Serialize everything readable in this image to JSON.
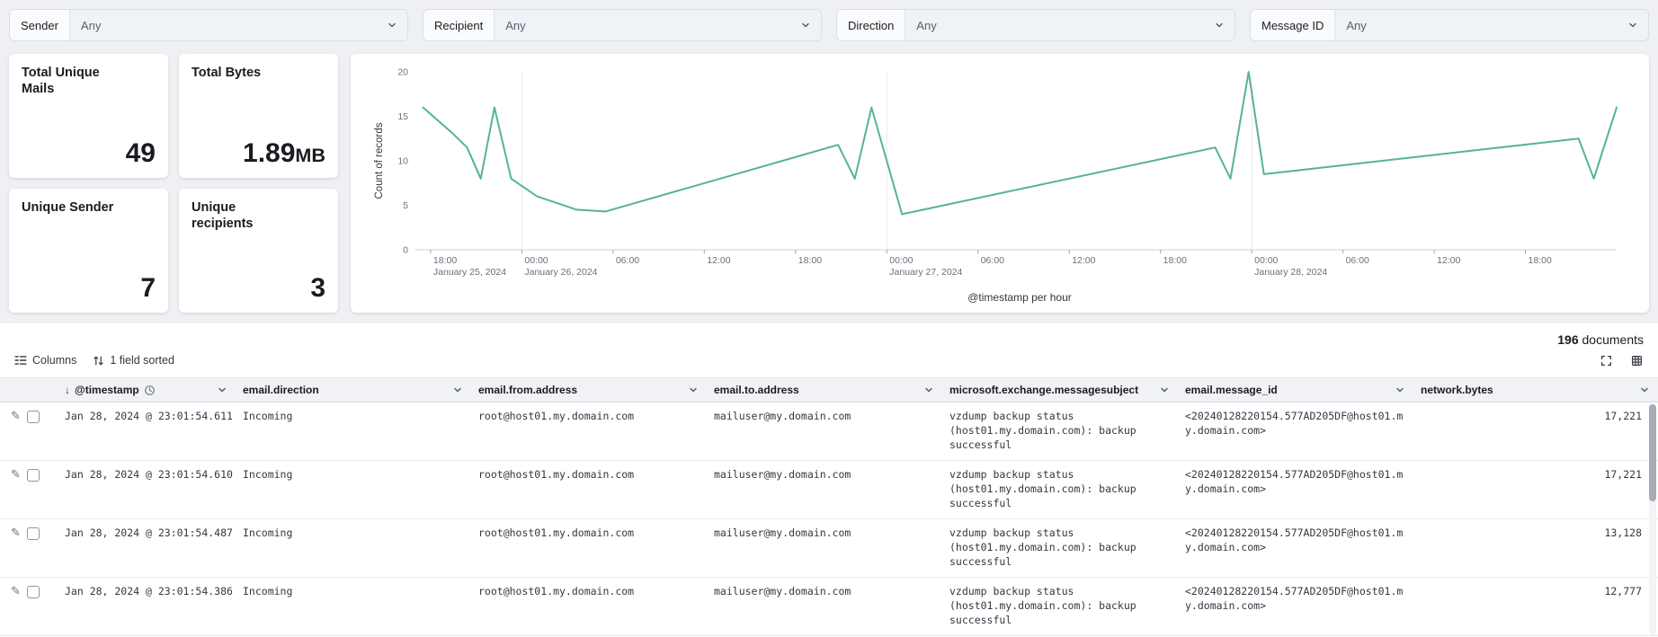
{
  "filters": [
    {
      "label": "Sender",
      "value": "Any"
    },
    {
      "label": "Recipient",
      "value": "Any"
    },
    {
      "label": "Direction",
      "value": "Any"
    },
    {
      "label": "Message ID",
      "value": "Any"
    }
  ],
  "metrics": [
    {
      "title": "Total Unique Mails",
      "value": "49",
      "unit": ""
    },
    {
      "title": "Total Bytes",
      "value": "1.89",
      "unit": "MB"
    },
    {
      "title": "Unique Sender",
      "value": "7",
      "unit": ""
    },
    {
      "title": "Unique recipients",
      "value": "3",
      "unit": ""
    }
  ],
  "chart_data": {
    "type": "line",
    "ylabel": "Count of records",
    "xlabel": "@timestamp per hour",
    "ylim": [
      0,
      20
    ],
    "y_ticks": [
      0,
      5,
      10,
      15,
      20
    ],
    "x_domain_hours": [
      0,
      79
    ],
    "x_domain_note": "hours since 2024-01-25 17:00",
    "line_color": "#54b399",
    "grid_color": "#e6e9ef",
    "day_gridlines_hours": [
      7,
      31,
      55
    ],
    "x_ticks": [
      {
        "hour": 1,
        "time": "18:00",
        "date": "January 25, 2024"
      },
      {
        "hour": 7,
        "time": "00:00",
        "date": "January 26, 2024"
      },
      {
        "hour": 13,
        "time": "06:00"
      },
      {
        "hour": 19,
        "time": "12:00"
      },
      {
        "hour": 25,
        "time": "18:00"
      },
      {
        "hour": 31,
        "time": "00:00",
        "date": "January 27, 2024"
      },
      {
        "hour": 37,
        "time": "06:00"
      },
      {
        "hour": 43,
        "time": "12:00"
      },
      {
        "hour": 49,
        "time": "18:00"
      },
      {
        "hour": 55,
        "time": "00:00",
        "date": "January 28, 2024"
      },
      {
        "hour": 61,
        "time": "06:00"
      },
      {
        "hour": 67,
        "time": "12:00"
      },
      {
        "hour": 73,
        "time": "18:00"
      }
    ],
    "points": [
      [
        0.5,
        16
      ],
      [
        2.5,
        13
      ],
      [
        3.4,
        11.5
      ],
      [
        4.3,
        8
      ],
      [
        5.2,
        16
      ],
      [
        6.3,
        8
      ],
      [
        8,
        6
      ],
      [
        10.6,
        4.5
      ],
      [
        12.5,
        4.3
      ],
      [
        27.8,
        11.8
      ],
      [
        28.9,
        8
      ],
      [
        30,
        16
      ],
      [
        32,
        4
      ],
      [
        52.6,
        11.5
      ],
      [
        53.6,
        8
      ],
      [
        54.8,
        20
      ],
      [
        55.8,
        8.5
      ],
      [
        76.5,
        12.5
      ],
      [
        77.5,
        8
      ],
      [
        79,
        16
      ]
    ]
  },
  "results": {
    "count": "196",
    "count_label": "documents"
  },
  "toolbar": {
    "columns_label": "Columns",
    "sorted_label": "1 field sorted"
  },
  "table": {
    "columns": [
      {
        "key": "timestamp",
        "label": "@timestamp"
      },
      {
        "key": "direction",
        "label": "email.direction"
      },
      {
        "key": "from",
        "label": "email.from.address"
      },
      {
        "key": "to",
        "label": "email.to.address"
      },
      {
        "key": "subject",
        "label": "microsoft.exchange.messagesubject"
      },
      {
        "key": "message_id",
        "label": "email.message_id"
      },
      {
        "key": "bytes",
        "label": "network.bytes"
      }
    ],
    "rows": [
      {
        "timestamp": "Jan 28, 2024 @ 23:01:54.611",
        "direction": "Incoming",
        "from": "root@host01.my.domain.com",
        "to": "mailuser@my.domain.com",
        "subject": "vzdump backup status (host01.my.domain.com): backup successful",
        "message_id": "<20240128220154.577AD205DF@host01.my.domain.com>",
        "bytes": "17,221"
      },
      {
        "timestamp": "Jan 28, 2024 @ 23:01:54.610",
        "direction": "Incoming",
        "from": "root@host01.my.domain.com",
        "to": "mailuser@my.domain.com",
        "subject": "vzdump backup status (host01.my.domain.com): backup successful",
        "message_id": "<20240128220154.577AD205DF@host01.my.domain.com>",
        "bytes": "17,221"
      },
      {
        "timestamp": "Jan 28, 2024 @ 23:01:54.487",
        "direction": "Incoming",
        "from": "root@host01.my.domain.com",
        "to": "mailuser@my.domain.com",
        "subject": "vzdump backup status (host01.my.domain.com): backup successful",
        "message_id": "<20240128220154.577AD205DF@host01.my.domain.com>",
        "bytes": "13,128"
      },
      {
        "timestamp": "Jan 28, 2024 @ 23:01:54.386",
        "direction": "Incoming",
        "from": "root@host01.my.domain.com",
        "to": "mailuser@my.domain.com",
        "subject": "vzdump backup status (host01.my.domain.com): backup successful",
        "message_id": "<20240128220154.577AD205DF@host01.my.domain.com>",
        "bytes": "12,777"
      }
    ]
  }
}
